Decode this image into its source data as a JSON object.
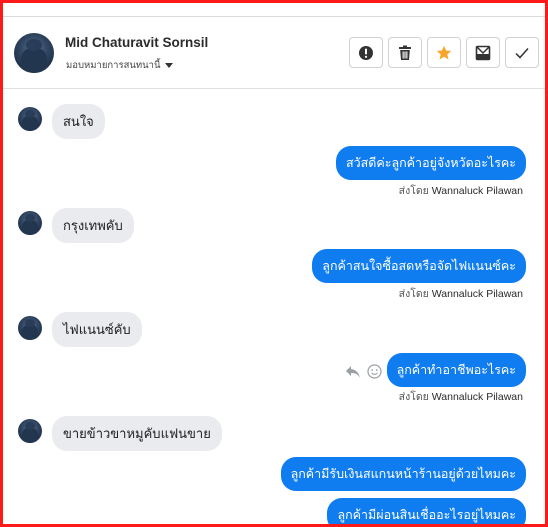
{
  "header": {
    "contact_name": "Mid Chaturavit Sornsil",
    "assign_label": "มอบหมายการสนทนานี้",
    "actions": [
      "alert-icon",
      "trash-icon",
      "star-icon",
      "archive-icon",
      "check-icon"
    ],
    "star_color": "#f7a52a"
  },
  "messages": [
    {
      "direction": "in",
      "text": "สนใจ"
    },
    {
      "direction": "out",
      "text": "สวัสดีค่ะลูกค้าอยู่จังหวัดอะไรคะ",
      "sent_by_prefix": "ส่งโดย",
      "sent_by_name": "Wannaluck Pilawan"
    },
    {
      "direction": "in",
      "text": "กรุงเทพคับ"
    },
    {
      "direction": "out",
      "text": "ลูกค้าสนใจซื้อสดหรือจัดไฟแนนซ์คะ",
      "sent_by_prefix": "ส่งโดย",
      "sent_by_name": "Wannaluck Pilawan"
    },
    {
      "direction": "in",
      "text": "ไฟแนนซ์คับ"
    },
    {
      "direction": "out",
      "text": "ลูกค้าทำอาชีพอะไรคะ",
      "sent_by_prefix": "ส่งโดย",
      "sent_by_name": "Wannaluck Pilawan"
    },
    {
      "direction": "in",
      "text": "ขายข้าวขาหมูคับแฟนขาย"
    },
    {
      "direction": "out",
      "text": "ลูกค้ามีรับเงินสแกนหน้าร้านอยู่ด้วยไหมคะ"
    },
    {
      "direction": "out",
      "text": "ลูกค้ามีผ่อนสินเชื่ออะไรอยู่ไหมคะ"
    }
  ],
  "colors": {
    "outgoing_bubble": "#0f7cf0",
    "incoming_bubble": "#e9ebee",
    "frame_border": "#ff1a1a"
  }
}
